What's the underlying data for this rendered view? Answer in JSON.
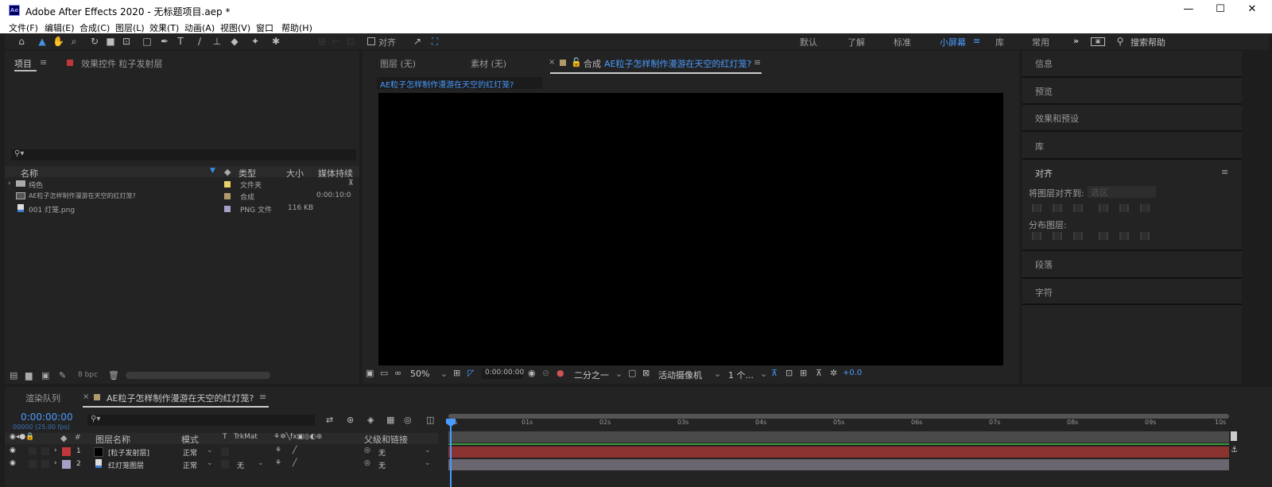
{
  "window": {
    "title": "Adobe After Effects 2020 - 无标题项目.aep *",
    "logo": "Ae",
    "minimize": "—",
    "maximize": "☐",
    "close": "✕"
  },
  "menu": [
    "文件(F)",
    "编辑(E)",
    "合成(C)",
    "图层(L)",
    "效果(T)",
    "动画(A)",
    "视图(V)",
    "窗口",
    "帮助(H)"
  ],
  "toolbar": {
    "align_label": "对齐",
    "workspaces": [
      "默认",
      "了解",
      "标准",
      "小屏幕",
      "库",
      "常用"
    ],
    "active_workspace": "小屏幕",
    "more": "»",
    "search_placeholder": "搜索帮助"
  },
  "project_panel": {
    "tab": "项目",
    "effects_tab": "效果控件 粒子发射层",
    "columns": [
      "名称",
      "类型",
      "大小",
      "媒体持续"
    ],
    "items": [
      {
        "name": "纯色",
        "type": "文件夹",
        "size": "",
        "duration": "",
        "label_color": "#e8d06a"
      },
      {
        "name": "AE粒子怎样制作漫游在天空的红灯笼?",
        "type": "合成",
        "size": "",
        "duration": "0:00:10:0",
        "label_color": "#b09a6b"
      },
      {
        "name": "001 灯笼.png",
        "type": "PNG 文件",
        "size": "116 KB",
        "duration": "",
        "label_color": "#a6a0c8"
      }
    ],
    "footer_bpc": "8 bpc"
  },
  "viewer": {
    "tabs": [
      "图层 (无)",
      "素材 (无)"
    ],
    "comp_tab_prefix": "合成",
    "comp_name": "AE粒子怎样制作漫游在天空的红灯笼?",
    "breadcrumb": "AE粒子怎样制作漫游在天空的红灯笼?",
    "zoom": "50%",
    "timecode": "0:00:00:00",
    "resolution": "二分之一",
    "camera": "活动摄像机",
    "views": "1 个...",
    "exposure": "+0.0"
  },
  "right_panels": {
    "items": [
      "信息",
      "预览",
      "效果和预设",
      "库"
    ],
    "align_title": "对齐",
    "align_to_label": "将图层对齐到:",
    "align_to_value": "选区",
    "distribute_label": "分布图层:",
    "bottom_items": [
      "段落",
      "字符"
    ]
  },
  "timeline": {
    "render_tab": "渲染队列",
    "comp_tab": "AE粒子怎样制作漫游在天空的红灯笼?",
    "timecode": "0:00:00:00",
    "fps": "00000 (25.00 fps)",
    "columns": {
      "num": "#",
      "name": "图层名称",
      "mode": "模式",
      "t": "T",
      "trkmat": "TrkMat",
      "parent": "父级和链接"
    },
    "ruler": [
      "0s",
      "01s",
      "02s",
      "03s",
      "04s",
      "05s",
      "06s",
      "07s",
      "08s",
      "09s",
      "10s"
    ],
    "layers": [
      {
        "num": "1",
        "name": "[粒子发射层]",
        "mode": "正常",
        "trkmat": "",
        "parent": "无",
        "label_color": "#c0383b",
        "bar_color": "#8a3331"
      },
      {
        "num": "2",
        "name": "红灯笼图层",
        "mode": "正常",
        "trkmat": "无",
        "parent": "无",
        "label_color": "#a6a0c8",
        "bar_color": "#6a6670"
      }
    ]
  }
}
